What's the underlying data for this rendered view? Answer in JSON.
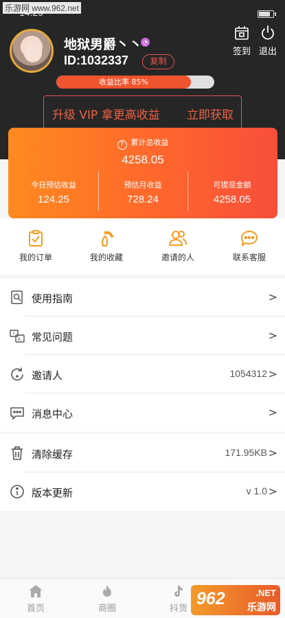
{
  "watermark": {
    "top_text": "乐游网 www.962.net",
    "logo_number": "962",
    "logo_net": ".NET",
    "logo_site": "乐游网"
  },
  "status_bar": {
    "time": "14:29",
    "battery_level": 0.8
  },
  "profile": {
    "username": "地狱男爵丶丶",
    "user_id": "ID:1032337",
    "copy_label": "复制",
    "signin_label": "签到",
    "logout_label": "退出",
    "progress_label": "收益比率 85%",
    "progress_value": 0.85
  },
  "vip_banner": {
    "text": "升级 VIP 拿更高收益",
    "action": "立即获取"
  },
  "earnings": {
    "total_label": "累计总收益",
    "total_value": "4258.05",
    "columns": [
      {
        "label": "今日预估收益",
        "value": "124.25"
      },
      {
        "label": "预估月收益",
        "value": "728.24"
      },
      {
        "label": "可提现金额",
        "value": "4258.05"
      }
    ]
  },
  "quick_links": [
    {
      "label": "我的订单",
      "icon": "clipboard-check-icon"
    },
    {
      "label": "我的收藏",
      "icon": "footprint-icon"
    },
    {
      "label": "邀请的人",
      "icon": "people-icon"
    },
    {
      "label": "联系客服",
      "icon": "chat-bubble-icon"
    }
  ],
  "menu": {
    "group1": [
      {
        "label": "使用指南",
        "value": "",
        "icon": "guide-search-icon"
      },
      {
        "label": "常见问题",
        "value": "",
        "icon": "faq-icon"
      },
      {
        "label": "邀请人",
        "value": "1054312",
        "icon": "refresh-icon"
      },
      {
        "label": "消息中心",
        "value": "",
        "icon": "message-icon"
      }
    ],
    "group2": [
      {
        "label": "清除缓存",
        "value": "171.95KB",
        "icon": "trash-icon"
      },
      {
        "label": "版本更新",
        "value": "v 1.0",
        "icon": "info-icon"
      }
    ],
    "chevron": ">"
  },
  "bottom_nav": [
    {
      "label": "首页",
      "icon": "home-icon"
    },
    {
      "label": "商圈",
      "icon": "flame-icon"
    },
    {
      "label": "抖货",
      "icon": "music-note-icon"
    }
  ]
}
